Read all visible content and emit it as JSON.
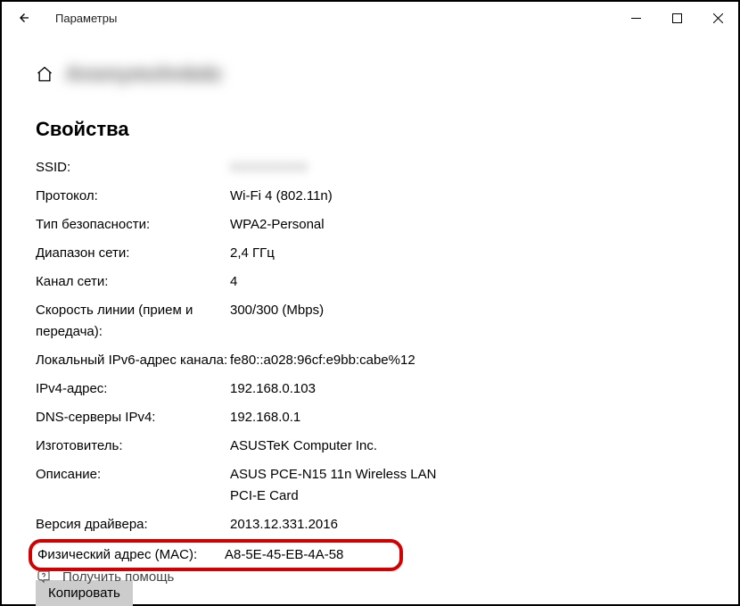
{
  "titlebar": {
    "app_title": "Параметры"
  },
  "header": {
    "network_name_blurred": "Anonymzhnbdz"
  },
  "section": {
    "title": "Свойства"
  },
  "props": {
    "ssid_label": "SSID:",
    "ssid_value": "XXXXXXXX",
    "protocol_label": "Протокол:",
    "protocol_value": "Wi-Fi 4 (802.11n)",
    "security_label": "Тип безопасности:",
    "security_value": "WPA2-Personal",
    "band_label": "Диапазон сети:",
    "band_value": "2,4 ГГц",
    "channel_label": "Канал сети:",
    "channel_value": "4",
    "link_speed_label": "Скорость линии (прием и передача):",
    "link_speed_value": "300/300 (Mbps)",
    "ipv6_local_label": "Локальный IPv6-адрес канала:",
    "ipv6_local_value": "fe80::a028:96cf:e9bb:cabe%12",
    "ipv4_label": "IPv4-адрес:",
    "ipv4_value": "192.168.0.103",
    "dns_label": "DNS-серверы IPv4:",
    "dns_value": "192.168.0.1",
    "manufacturer_label": "Изготовитель:",
    "manufacturer_value": "ASUSTeK Computer Inc.",
    "description_label": "Описание:",
    "description_value": "ASUS PCE-N15 11n Wireless LAN PCI-E Card",
    "driver_ver_label": "Версия драйвера:",
    "driver_ver_value": "2013.12.331.2016",
    "mac_label": "Физический адрес (MAC):",
    "mac_value": "A8-5E-45-EB-4A-58"
  },
  "buttons": {
    "copy": "Копировать"
  },
  "help": {
    "text": "Получить помощь"
  }
}
